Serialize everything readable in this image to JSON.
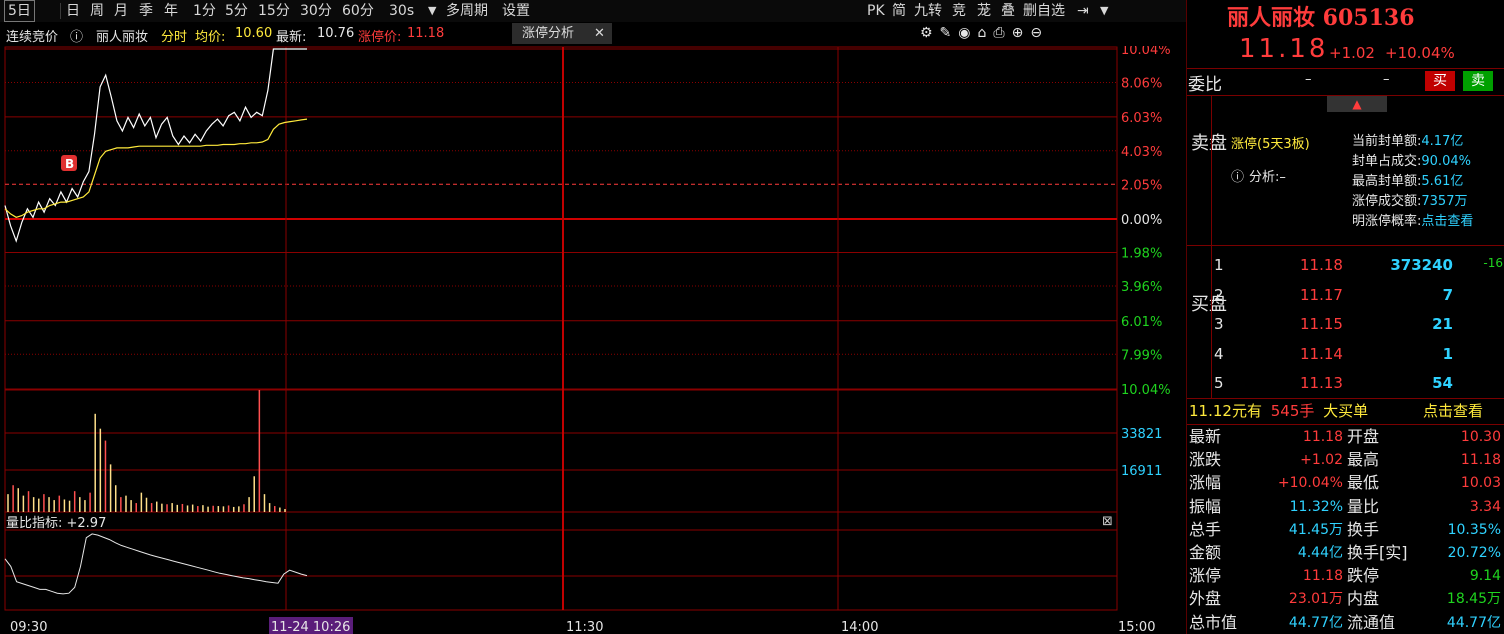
{
  "toolbar": {
    "periods": [
      "5日",
      "日",
      "周",
      "月",
      "季",
      "年",
      "1分",
      "5分",
      "15分",
      "30分",
      "60分",
      "30s"
    ],
    "multi_period": "多周期",
    "settings": "设置",
    "right_tools": [
      "PK",
      "简",
      "九转",
      "竞",
      "茏",
      "叠",
      "删自选"
    ]
  },
  "infoline": {
    "auction": "连续竞价",
    "stock_name": "丽人丽妆",
    "mode": "分时",
    "avg_label": "均价:",
    "avg_value": "10.60",
    "latest_label": "最新:",
    "latest_value": "10.76",
    "limit_label": "涨停价:",
    "limit_value": "11.18",
    "tab_label": "涨停分析"
  },
  "axis": {
    "right_pct": [
      "10.04%",
      "8.06%",
      "6.03%",
      "4.03%",
      "2.05%",
      "0.00%",
      "1.98%",
      "3.96%",
      "6.01%",
      "7.99%",
      "10.04%"
    ],
    "volume": [
      "33821",
      "16911"
    ],
    "times": [
      "09:30",
      "11-24 10:26",
      "11:30",
      "14:00",
      "15:00"
    ],
    "indicator_label": "量比指标: +2.97"
  },
  "chart_data": {
    "type": "line",
    "title": "",
    "xlabel": "",
    "ylabel": "",
    "x_ticks": [
      "09:30",
      "11:30",
      "14:00",
      "15:00"
    ],
    "ylim_pct": [
      -10.04,
      10.04
    ],
    "prev_close": 10.16,
    "series": [
      {
        "values": [
          0.8,
          -0.4,
          -1.3,
          -0.2,
          0.6,
          0.1,
          1.0,
          0.4,
          1.2,
          0.8,
          1.6,
          1.0,
          1.8,
          1.3,
          2.2,
          2.8,
          5.0,
          7.8,
          8.5,
          7.2,
          5.8,
          5.2,
          6.0,
          5.4,
          6.2,
          5.5,
          6.0,
          4.8,
          5.6,
          6.0,
          4.9,
          4.4,
          4.9,
          4.5,
          5.0,
          4.6,
          5.2,
          5.6,
          5.9,
          5.5,
          6.1,
          6.3,
          5.8,
          6.6,
          6.0,
          6.3,
          6.1,
          7.6,
          10.04,
          10.04,
          10.04,
          10.04,
          10.04,
          10.04,
          10.04
        ]
      },
      {
        "values": [
          0.6,
          0.3,
          0.1,
          0.2,
          0.4,
          0.5,
          0.6,
          0.6,
          0.8,
          0.9,
          1.0,
          1.0,
          1.1,
          1.2,
          1.3,
          1.6,
          2.6,
          3.6,
          4.0,
          4.1,
          4.2,
          4.2,
          4.2,
          4.25,
          4.3,
          4.3,
          4.3,
          4.3,
          4.3,
          4.3,
          4.3,
          4.3,
          4.3,
          4.3,
          4.3,
          4.3,
          4.35,
          4.35,
          4.35,
          4.4,
          4.4,
          4.4,
          4.45,
          4.45,
          4.5,
          4.5,
          4.55,
          4.7,
          5.3,
          5.6,
          5.7,
          5.75,
          5.8,
          5.85,
          5.9
        ]
      }
    ],
    "volume": [
      6000,
      9000,
      8000,
      5500,
      7000,
      5000,
      4500,
      6000,
      5000,
      4000,
      5500,
      4200,
      3800,
      7000,
      5000,
      4000,
      6500,
      33000,
      28000,
      24000,
      16000,
      9000,
      5000,
      5500,
      4000,
      3000,
      6500,
      4800,
      3000,
      3500,
      2800,
      2600,
      3000,
      2400,
      2700,
      2200,
      2500,
      2000,
      2300,
      1800,
      2100,
      2000,
      1900,
      2200,
      1700,
      1900,
      2600,
      5000,
      12000,
      41000,
      6000,
      3000,
      2000,
      1500,
      1000
    ],
    "indicator": [
      2.2,
      2.0,
      1.6,
      1.55,
      1.5,
      1.45,
      1.4,
      1.4,
      1.35,
      1.3,
      1.28,
      1.3,
      1.45,
      2.0,
      2.75,
      2.85,
      2.82,
      2.76,
      2.7,
      2.62,
      2.55,
      2.5,
      2.45,
      2.4,
      2.35,
      2.3,
      2.26,
      2.22,
      2.18,
      2.14,
      2.1,
      2.06,
      2.02,
      1.98,
      1.94,
      1.9,
      1.86,
      1.82,
      1.79,
      1.76,
      1.73,
      1.7,
      1.68,
      1.65,
      1.63,
      1.6,
      1.58,
      1.56,
      1.8,
      1.9,
      1.85,
      1.8,
      1.76
    ]
  },
  "panel": {
    "title": "丽人丽妆 605136",
    "price": "11.18",
    "change": "+1.02",
    "change_pct": "+10.04%",
    "weibi_label": "委比",
    "dash1": "–",
    "dash2": "–",
    "buy_btn": "买",
    "sell_btn": "卖",
    "sell_label": "卖盘",
    "limit_title": "涨停(5天3板)",
    "analysis_label": "分析:–",
    "seal_rows": [
      {
        "label": "当前封单额:",
        "value": "4.17亿"
      },
      {
        "label": "封单占成交:",
        "value": "90.04%"
      },
      {
        "label": "最高封单额:",
        "value": "5.61亿"
      },
      {
        "label": "涨停成交额:",
        "value": "7357万"
      },
      {
        "label": "明涨停概率:",
        "value": "点击查看"
      }
    ],
    "buy_label": "买盘",
    "bids": [
      {
        "level": "1",
        "price": "11.18",
        "vol": "373240",
        "delta": "-16"
      },
      {
        "level": "2",
        "price": "11.17",
        "vol": "7",
        "delta": ""
      },
      {
        "level": "3",
        "price": "11.15",
        "vol": "21",
        "delta": ""
      },
      {
        "level": "4",
        "price": "11.14",
        "vol": "1",
        "delta": ""
      },
      {
        "level": "5",
        "price": "11.13",
        "vol": "54",
        "delta": ""
      }
    ],
    "bigbuy": {
      "price": "11.12元有",
      "qty": "545手",
      "text": "大买单",
      "link": "点击查看"
    },
    "stats": [
      {
        "l1": "最新",
        "v1": "11.18",
        "l2": "开盘",
        "v2": "10.30",
        "c1": "red",
        "c2": "red"
      },
      {
        "l1": "涨跌",
        "v1": "+1.02",
        "l2": "最高",
        "v2": "11.18",
        "c1": "red",
        "c2": "red"
      },
      {
        "l1": "涨幅",
        "v1": "+10.04%",
        "l2": "最低",
        "v2": "10.03",
        "c1": "red",
        "c2": "red"
      },
      {
        "l1": "振幅",
        "v1": "11.32%",
        "l2": "量比",
        "v2": "3.34",
        "c1": "cyan",
        "c2": "red"
      },
      {
        "l1": "总手",
        "v1": "41.45万",
        "l2": "换手",
        "v2": "10.35%",
        "c1": "cyan",
        "c2": "cyan"
      },
      {
        "l1": "金额",
        "v1": "4.44亿",
        "l2": "换手[实]",
        "v2": "20.72%",
        "c1": "cyan",
        "c2": "cyan"
      },
      {
        "l1": "涨停",
        "v1": "11.18",
        "l2": "跌停",
        "v2": "9.14",
        "c1": "red",
        "c2": "green"
      },
      {
        "l1": "外盘",
        "v1": "23.01万",
        "l2": "内盘",
        "v2": "18.45万",
        "c1": "red",
        "c2": "green"
      },
      {
        "l1": "总市值",
        "v1": "44.77亿",
        "l2": "流通值",
        "v2": "44.77亿",
        "c1": "cyan",
        "c2": "cyan"
      }
    ]
  }
}
